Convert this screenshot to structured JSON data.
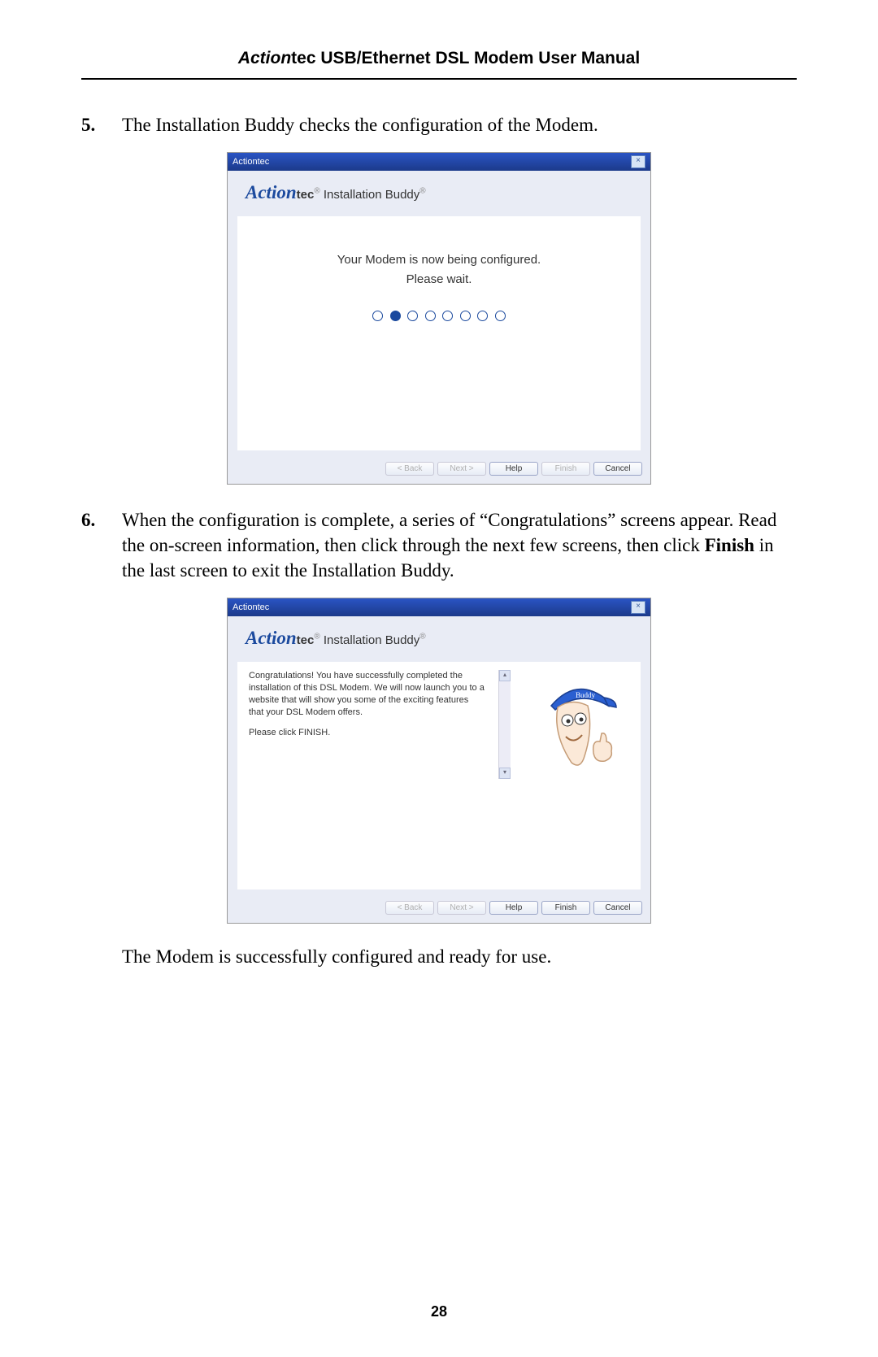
{
  "header": {
    "brand_italic": "Action",
    "brand_rest": "tec USB/Ethernet DSL Modem User Manual"
  },
  "step5": {
    "num": "5.",
    "text": "The Installation Buddy checks the configuration of the Modem."
  },
  "dialog1": {
    "titlebar": "Actiontec",
    "logo_script": "Action",
    "logo_bold": "tec",
    "logo_rest": " Installation Buddy",
    "reg": "®",
    "msg_line1": "Your Modem is now being configured.",
    "msg_line2": "Please wait.",
    "progress_active_index": 1,
    "progress_total": 8,
    "buttons": {
      "back": "< Back",
      "next": "Next >",
      "help": "Help",
      "finish": "Finish",
      "cancel": "Cancel"
    }
  },
  "step6": {
    "num": "6.",
    "text_a": "When the configuration is complete, a series of “Congratulations” screens appear. Read the on-screen information, then click through the next few screens, then click ",
    "bold": "Finish",
    "text_b": " in the last screen to exit the Installation Buddy."
  },
  "dialog2": {
    "titlebar": "Actiontec",
    "logo_script": "Action",
    "logo_bold": "tec",
    "logo_rest": " Installation Buddy",
    "reg": "®",
    "para1": "Congratulations!  You have successfully completed the installation of this DSL Modem.  We will now launch you to a website that will show you some of the exciting features that your DSL Modem offers.",
    "para2": "Please click FINISH.",
    "mascot_cap_label": "Buddy",
    "buttons": {
      "back": "< Back",
      "next": "Next >",
      "help": "Help",
      "finish": "Finish",
      "cancel": "Cancel"
    }
  },
  "post_text": "The Modem is successfully configured and ready for use.",
  "page_number": "28"
}
